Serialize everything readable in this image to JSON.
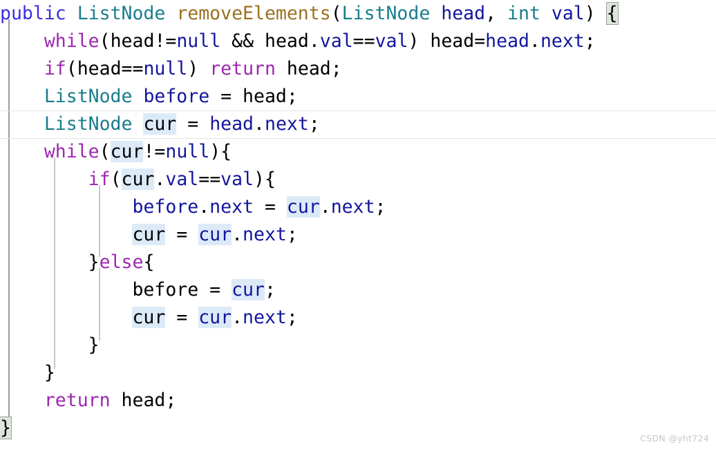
{
  "editor": {
    "language": "java",
    "background": "#ffffff",
    "font_size_px": 26.5,
    "line_height_px": 40,
    "colors": {
      "modifier": "#3a2ee0",
      "type": "#1a7d8c",
      "method": "#9a7120",
      "keyword": "#9c27b0",
      "identifier": "#12169c",
      "plain": "#000000",
      "occurrence_highlight": "#dceaf8",
      "bracket_match": "#dde5dc",
      "indent_guide_active": "#9a9a9a",
      "indent_guide": "#c8c8c8",
      "current_line_border": "#e4e4e4",
      "watermark": "#c8c8c8"
    },
    "current_line_index": 4,
    "highlighted_occurrence": "cur",
    "matched_brackets": [
      "{",
      "}"
    ]
  },
  "code": {
    "full_text": "public ListNode removeElements(ListNode head, int val) {\n    while(head!=null && head.val==val) head=head.next;\n    if(head==null) return head;\n    ListNode before = head;\n    ListNode cur = head.next;\n    while(cur!=null){\n        if(cur.val==val){\n            before.next = cur.next;\n            cur = cur.next;\n        }else{\n            before = cur;\n            cur = cur.next;\n        }\n    }\n    return head;\n}",
    "lines": [
      "public ListNode removeElements(ListNode head, int val) {",
      "    while(head!=null && head.val==val) head=head.next;",
      "    if(head==null) return head;",
      "    ListNode before = head;",
      "    ListNode cur = head.next;",
      "    while(cur!=null){",
      "        if(cur.val==val){",
      "            before.next = cur.next;",
      "            cur = cur.next;",
      "        }else{",
      "            before = cur;",
      "            cur = cur.next;",
      "        }",
      "    }",
      "    return head;",
      "}"
    ],
    "tokens": {
      "l0": {
        "mod": "public",
        "type1": "ListNode",
        "method": "removeElements",
        "type2": "ListNode",
        "p1": "head",
        "type3": "int",
        "p2": "val",
        "brace": "{"
      },
      "l1": {
        "kw": "while",
        "a": "head",
        "null": "null",
        "b": "head",
        "val": "val",
        "c": "val",
        "d": "head",
        "e": "head",
        "next": "next"
      },
      "l2": {
        "kw": "if",
        "a": "head",
        "null": "null",
        "ret": "return",
        "b": "head"
      },
      "l3": {
        "type": "ListNode",
        "name": "before",
        "rhs": "head"
      },
      "l4": {
        "type": "ListNode",
        "name": "cur",
        "rhs": "head",
        "next": "next"
      },
      "l5": {
        "kw": "while",
        "a": "cur",
        "null": "null"
      },
      "l6": {
        "kw": "if",
        "a": "cur",
        "val": "val",
        "b": "val"
      },
      "l7": {
        "a": "before",
        "next1": "next",
        "b": "cur",
        "next2": "next"
      },
      "l8": {
        "a": "cur",
        "b": "cur",
        "next": "next"
      },
      "l9": {
        "kw": "else"
      },
      "l10": {
        "a": "before",
        "b": "cur"
      },
      "l11": {
        "a": "cur",
        "b": "cur",
        "next": "next"
      },
      "l12": {},
      "l13": {},
      "l14": {
        "kw": "return",
        "a": "head"
      },
      "l15": {
        "brace": "}"
      }
    }
  },
  "watermark": {
    "text": "CSDN @yht724"
  }
}
